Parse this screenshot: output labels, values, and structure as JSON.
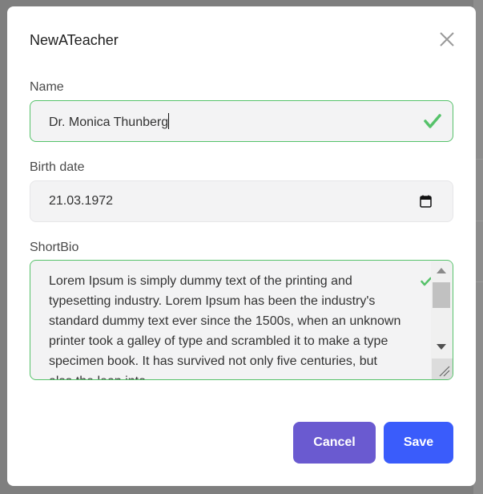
{
  "dialog": {
    "title": "NewATeacher",
    "close_icon": "close-icon"
  },
  "fields": {
    "name": {
      "label": "Name",
      "value": "Dr. Monica Thunberg",
      "status_icon": "check-icon"
    },
    "birth_date": {
      "label": "Birth date",
      "value": "21.03.1972",
      "icon": "calendar-icon"
    },
    "short_bio": {
      "label": "ShortBio",
      "value": "Lorem Ipsum is simply dummy text of the printing and typesetting industry. Lorem Ipsum has been the industry's standard dummy text ever since the 1500s, when an unknown printer took a galley of type and scrambled it to make a type specimen book. It has survived not only five centuries, but also the leap into",
      "status_icon": "check-icon"
    }
  },
  "actions": {
    "cancel_label": "Cancel",
    "save_label": "Save"
  },
  "colors": {
    "valid": "#56c26a",
    "cancel": "#6a5ad0",
    "save": "#3a5cfb"
  }
}
